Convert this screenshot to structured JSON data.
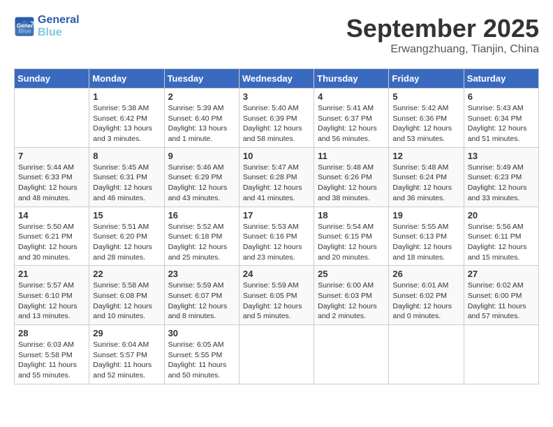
{
  "logo": {
    "line1": "General",
    "line2": "Blue"
  },
  "title": "September 2025",
  "location": "Erwangzhuang, Tianjin, China",
  "days_of_week": [
    "Sunday",
    "Monday",
    "Tuesday",
    "Wednesday",
    "Thursday",
    "Friday",
    "Saturday"
  ],
  "weeks": [
    [
      {
        "num": "",
        "detail": ""
      },
      {
        "num": "1",
        "detail": "Sunrise: 5:38 AM\nSunset: 6:42 PM\nDaylight: 13 hours\nand 3 minutes."
      },
      {
        "num": "2",
        "detail": "Sunrise: 5:39 AM\nSunset: 6:40 PM\nDaylight: 13 hours\nand 1 minute."
      },
      {
        "num": "3",
        "detail": "Sunrise: 5:40 AM\nSunset: 6:39 PM\nDaylight: 12 hours\nand 58 minutes."
      },
      {
        "num": "4",
        "detail": "Sunrise: 5:41 AM\nSunset: 6:37 PM\nDaylight: 12 hours\nand 56 minutes."
      },
      {
        "num": "5",
        "detail": "Sunrise: 5:42 AM\nSunset: 6:36 PM\nDaylight: 12 hours\nand 53 minutes."
      },
      {
        "num": "6",
        "detail": "Sunrise: 5:43 AM\nSunset: 6:34 PM\nDaylight: 12 hours\nand 51 minutes."
      }
    ],
    [
      {
        "num": "7",
        "detail": "Sunrise: 5:44 AM\nSunset: 6:33 PM\nDaylight: 12 hours\nand 48 minutes."
      },
      {
        "num": "8",
        "detail": "Sunrise: 5:45 AM\nSunset: 6:31 PM\nDaylight: 12 hours\nand 46 minutes."
      },
      {
        "num": "9",
        "detail": "Sunrise: 5:46 AM\nSunset: 6:29 PM\nDaylight: 12 hours\nand 43 minutes."
      },
      {
        "num": "10",
        "detail": "Sunrise: 5:47 AM\nSunset: 6:28 PM\nDaylight: 12 hours\nand 41 minutes."
      },
      {
        "num": "11",
        "detail": "Sunrise: 5:48 AM\nSunset: 6:26 PM\nDaylight: 12 hours\nand 38 minutes."
      },
      {
        "num": "12",
        "detail": "Sunrise: 5:48 AM\nSunset: 6:24 PM\nDaylight: 12 hours\nand 36 minutes."
      },
      {
        "num": "13",
        "detail": "Sunrise: 5:49 AM\nSunset: 6:23 PM\nDaylight: 12 hours\nand 33 minutes."
      }
    ],
    [
      {
        "num": "14",
        "detail": "Sunrise: 5:50 AM\nSunset: 6:21 PM\nDaylight: 12 hours\nand 30 minutes."
      },
      {
        "num": "15",
        "detail": "Sunrise: 5:51 AM\nSunset: 6:20 PM\nDaylight: 12 hours\nand 28 minutes."
      },
      {
        "num": "16",
        "detail": "Sunrise: 5:52 AM\nSunset: 6:18 PM\nDaylight: 12 hours\nand 25 minutes."
      },
      {
        "num": "17",
        "detail": "Sunrise: 5:53 AM\nSunset: 6:16 PM\nDaylight: 12 hours\nand 23 minutes."
      },
      {
        "num": "18",
        "detail": "Sunrise: 5:54 AM\nSunset: 6:15 PM\nDaylight: 12 hours\nand 20 minutes."
      },
      {
        "num": "19",
        "detail": "Sunrise: 5:55 AM\nSunset: 6:13 PM\nDaylight: 12 hours\nand 18 minutes."
      },
      {
        "num": "20",
        "detail": "Sunrise: 5:56 AM\nSunset: 6:11 PM\nDaylight: 12 hours\nand 15 minutes."
      }
    ],
    [
      {
        "num": "21",
        "detail": "Sunrise: 5:57 AM\nSunset: 6:10 PM\nDaylight: 12 hours\nand 13 minutes."
      },
      {
        "num": "22",
        "detail": "Sunrise: 5:58 AM\nSunset: 6:08 PM\nDaylight: 12 hours\nand 10 minutes."
      },
      {
        "num": "23",
        "detail": "Sunrise: 5:59 AM\nSunset: 6:07 PM\nDaylight: 12 hours\nand 8 minutes."
      },
      {
        "num": "24",
        "detail": "Sunrise: 5:59 AM\nSunset: 6:05 PM\nDaylight: 12 hours\nand 5 minutes."
      },
      {
        "num": "25",
        "detail": "Sunrise: 6:00 AM\nSunset: 6:03 PM\nDaylight: 12 hours\nand 2 minutes."
      },
      {
        "num": "26",
        "detail": "Sunrise: 6:01 AM\nSunset: 6:02 PM\nDaylight: 12 hours\nand 0 minutes."
      },
      {
        "num": "27",
        "detail": "Sunrise: 6:02 AM\nSunset: 6:00 PM\nDaylight: 11 hours\nand 57 minutes."
      }
    ],
    [
      {
        "num": "28",
        "detail": "Sunrise: 6:03 AM\nSunset: 5:58 PM\nDaylight: 11 hours\nand 55 minutes."
      },
      {
        "num": "29",
        "detail": "Sunrise: 6:04 AM\nSunset: 5:57 PM\nDaylight: 11 hours\nand 52 minutes."
      },
      {
        "num": "30",
        "detail": "Sunrise: 6:05 AM\nSunset: 5:55 PM\nDaylight: 11 hours\nand 50 minutes."
      },
      {
        "num": "",
        "detail": ""
      },
      {
        "num": "",
        "detail": ""
      },
      {
        "num": "",
        "detail": ""
      },
      {
        "num": "",
        "detail": ""
      }
    ]
  ]
}
